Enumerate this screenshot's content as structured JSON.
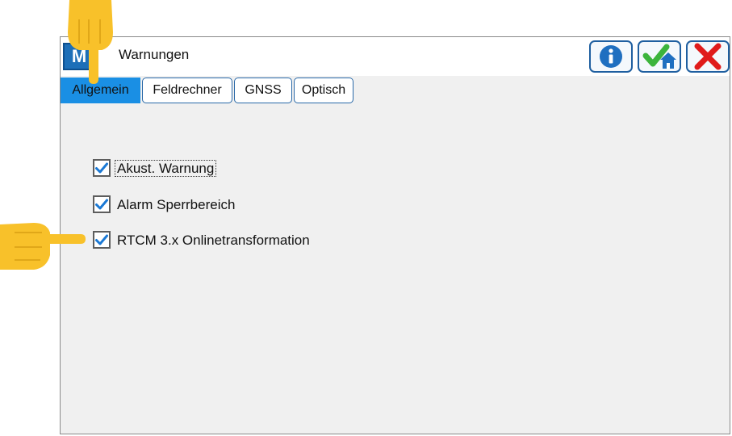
{
  "window": {
    "title": "Warnungen",
    "app_icon_text": "M",
    "buttons": [
      {
        "name": "info",
        "icon": "info-icon",
        "color": "#1f6fc0"
      },
      {
        "name": "ok-home",
        "icon": "check-home-icon",
        "color": "#3cb43c"
      },
      {
        "name": "close",
        "icon": "close-x-icon",
        "color": "#e01b1b"
      }
    ]
  },
  "tabs": [
    {
      "label": "Allgemein",
      "active": true
    },
    {
      "label": "Feldrechner",
      "active": false
    },
    {
      "label": "GNSS",
      "active": false
    },
    {
      "label": "Optisch",
      "active": false
    }
  ],
  "options": [
    {
      "label": "Akust. Warnung",
      "checked": true,
      "focused": true
    },
    {
      "label": "Alarm Sperrbereich",
      "checked": true,
      "focused": false
    },
    {
      "label": "RTCM 3.x Onlinetransformation",
      "checked": true,
      "focused": false
    }
  ],
  "annotations": {
    "pointer_color": "#f8c12a",
    "pointers": [
      "hand-pointer-down-icon",
      "hand-pointer-right-icon"
    ]
  },
  "colors": {
    "accent": "#1a8fe4",
    "check": "#1a78d4",
    "border": "#2a69a8"
  }
}
